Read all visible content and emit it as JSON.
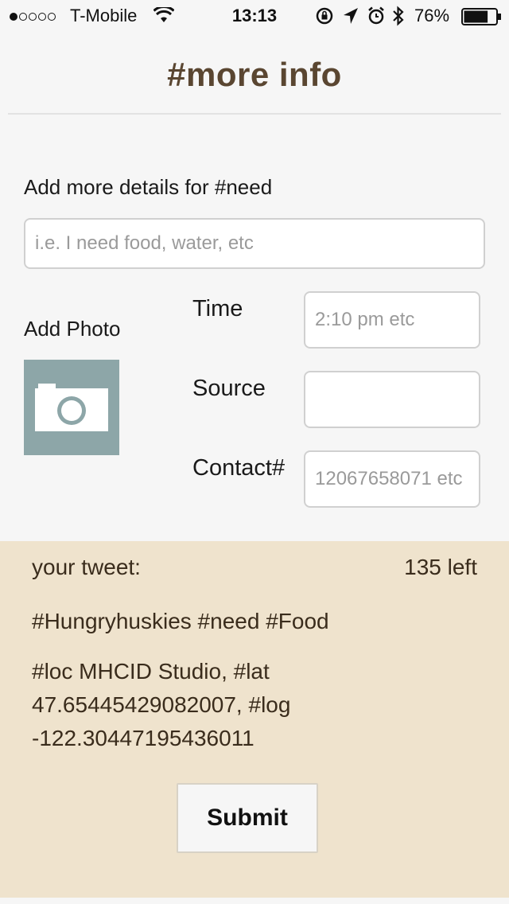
{
  "status_bar": {
    "carrier": "T-Mobile",
    "time": "13:13",
    "battery_percent": "76%",
    "battery_level": 0.76,
    "signal_dots": 5,
    "signal_filled": 1
  },
  "header": {
    "title": "#more info"
  },
  "form": {
    "details_label": "Add more details for #need",
    "details_placeholder": "i.e. I need food, water, etc",
    "photo_label": "Add Photo",
    "time_label": "Time",
    "time_placeholder": "2:10 pm etc",
    "source_label": "Source",
    "source_placeholder": "",
    "contact_label": "Contact#",
    "contact_placeholder": "12067658071 etc"
  },
  "tweet": {
    "label": "your tweet:",
    "remaining": "135 left",
    "line1": "#Hungryhuskies #need #Food",
    "line2": "#loc MHCID Studio, #lat",
    "line3": "47.65445429082007, #log",
    "line4": "-122.30447195436011"
  },
  "actions": {
    "submit_label": "Submit"
  },
  "colors": {
    "title": "#5a4631",
    "tweet_panel_bg": "#efe3cd",
    "photo_button_bg": "#8da6a8"
  }
}
